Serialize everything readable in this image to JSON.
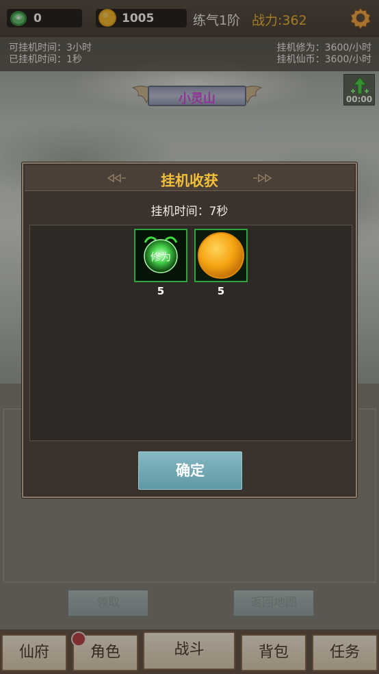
{
  "topbar": {
    "jade_count": "0",
    "gold_count": "1005",
    "rank": "练气1阶",
    "power": "战力:362"
  },
  "afk_info": {
    "available_time": "可挂机时间：3小时",
    "elapsed_time": "已挂机时间：1秒",
    "cultivation_rate": "挂机修为：3600/小时",
    "coin_rate": "挂机仙币：3600/小时"
  },
  "location": {
    "name": "小灵山"
  },
  "boost": {
    "timer": "00:00"
  },
  "modal": {
    "title": "挂机收获",
    "afk_time": "挂机时间：7秒",
    "rewards": [
      {
        "icon": "cultivation-orb-icon",
        "label": "修为",
        "count": "5"
      },
      {
        "icon": "gold-coin-icon",
        "count": "5"
      }
    ],
    "confirm_label": "确定"
  },
  "lower_panel": {
    "claim_label": "领取",
    "return_label": "返回地图"
  },
  "bottom_nav": {
    "items": [
      "仙府",
      "角色",
      "战斗",
      "背包",
      "任务"
    ]
  },
  "colors": {
    "power": "#f0b32b",
    "title_gold": "#f3be3a",
    "location_name": "#d43be0",
    "confirm_button": "#6fa6b1",
    "reward_border": "#2fa63c"
  }
}
